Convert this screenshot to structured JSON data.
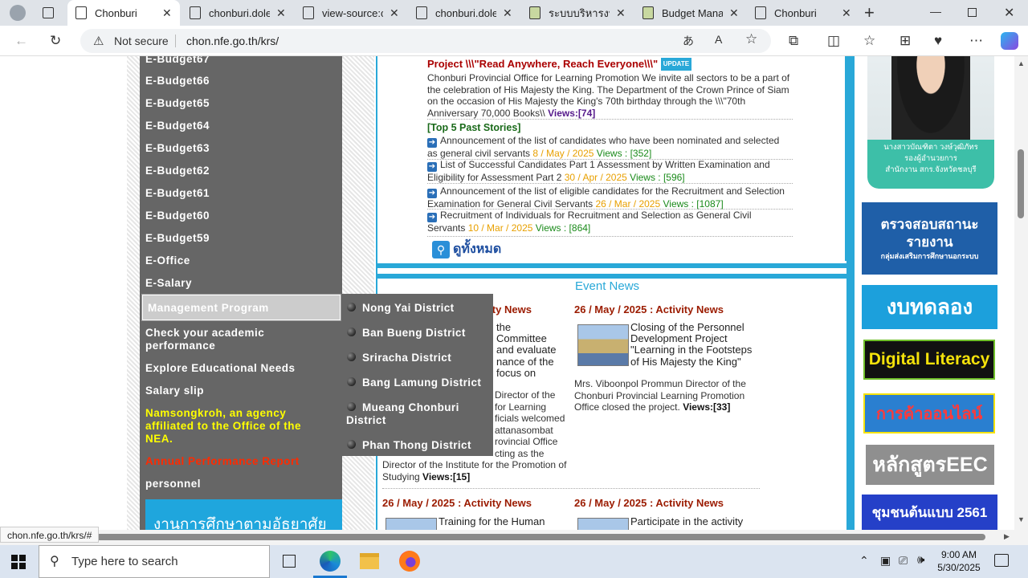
{
  "browser": {
    "tabs": [
      {
        "title": "Chonburi",
        "active": true
      },
      {
        "title": "chonburi.dole",
        "active": false
      },
      {
        "title": "view-source:c",
        "active": false
      },
      {
        "title": "chonburi.dole",
        "active": false
      },
      {
        "title": "ระบบบริหารงบป",
        "active": false
      },
      {
        "title": "Budget Manag",
        "active": false
      },
      {
        "title": "Chonburi",
        "active": false
      }
    ],
    "security_label": "Not secure",
    "url": "chon.nfe.go.th/krs/",
    "status_url": "chon.nfe.go.th/krs/#"
  },
  "sidebar": {
    "items": [
      {
        "label": "E-Budget67"
      },
      {
        "label": "E-Budget66"
      },
      {
        "label": "E-Budget65"
      },
      {
        "label": "E-Budget64"
      },
      {
        "label": "E-Budget63"
      },
      {
        "label": "E-Budget62"
      },
      {
        "label": "E-Budget61"
      },
      {
        "label": "E-Budget60"
      },
      {
        "label": "E-Budget59"
      },
      {
        "label": "E-Office"
      },
      {
        "label": "E-Salary"
      }
    ],
    "highlighted": "Management Program",
    "items_after": [
      {
        "label": "Check your academic performance"
      },
      {
        "label": "Explore Educational Needs"
      },
      {
        "label": "Salary slip"
      },
      {
        "label": "Namsongkroh, an agency affiliated to the Office of the NEA."
      },
      {
        "label": "Annual Performance Report"
      },
      {
        "label": "personnel"
      }
    ],
    "banner": "งานการศึกษาตามอัธยาศัย",
    "colors": {
      "background": "#666666",
      "yellow": "#ffff00",
      "red": "#ff2a00"
    }
  },
  "submenu": {
    "items": [
      {
        "label": "Nong Yai District"
      },
      {
        "label": "Ban Bueng District"
      },
      {
        "label": "Sriracha District"
      },
      {
        "label": "Bang Lamung District"
      },
      {
        "label": "Mueang Chonburi District"
      },
      {
        "label": "Phan Thong District"
      }
    ]
  },
  "content": {
    "top_story": {
      "title": "Project \\\\\\\"Read Anywhere, Reach Everyone\\\\\\\"",
      "badge": "UPDATE",
      "body": "Chonburi Provincial Office for Learning Promotion We invite all sectors to be a part of the celebration of His Majesty the King. The Department of the Crown Prince of Siam on the occasion of His Majesty the King's 70th birthday through the \\\\\\\"70th Anniversary 70,000 Books\\\\",
      "views_label": "Views:",
      "views": "[74]"
    },
    "past_title": "[Top 5 Past Stories]",
    "past_stories": [
      {
        "text": "Announcement of the list of candidates who have been nominated and selected as general civil servants",
        "date": "8 / May / 2025",
        "views": "Views : [352]"
      },
      {
        "text": "List of Successful Candidates Part 1 Assessment by Written Examination and Eligibility for Assessment Part 2",
        "date": "30 / Apr / 2025",
        "views": "Views : [596]"
      },
      {
        "text": "Announcement of the list of eligible candidates for the Recruitment and Selection Examination for General Civil Servants",
        "date": "26 / Mar / 2025",
        "views": "Views : [1087]"
      },
      {
        "text": "Recruitment of Individuals for Recruitment and Selection as General Civil Servants",
        "date": "10 / Mar / 2025",
        "views": "Views : [864]"
      }
    ],
    "view_all": "ดูทั้งหมด",
    "event_title": "Event News",
    "events": [
      {
        "heading": "26 / May / 2025 : Activity News",
        "title": "the ... Committee ... and evaluate ... nance of the ... focus on",
        "desc": "... Director of the ... for Learning ... ficials welcomed ... attanasombat ... rovincial Office ... cting as the Director of the Institute for the Promotion of Studying",
        "views": "Views:[15]"
      },
      {
        "heading": "26 / May / 2025 : Activity News",
        "title": "Closing of the Personnel Development Project \"Learning in the Footsteps of His Majesty the King\"",
        "desc": "Mrs. Viboonpol Prommun Director of the Chonburi Provincial Learning Promotion Office closed the project",
        "views": "Views:[33]"
      },
      {
        "heading": "26 / May / 2025 : Activity News",
        "title": "Training for the Human",
        "desc": "",
        "views": ""
      },
      {
        "heading": "26 / May / 2025 : Activity News",
        "title": "Participate in the activity",
        "desc": "",
        "views": ""
      }
    ]
  },
  "right": {
    "person_name": "นางสาวบัณฑิตา วงษ์วุฒิภัทร",
    "person_title": "รองผู้อำนวยการ",
    "person_org": "สำนักงาน สกร.จังหวัดชลบุรี",
    "banners": [
      {
        "line1": "ตรวจสอบสถานะ",
        "line2": "รายงาน",
        "line3": "กลุ่มส่งเสริมการศึกษานอกระบบ",
        "bg": "#1f5fa8"
      },
      {
        "line1": "งบทดลอง",
        "bg": "#1ca0dc"
      },
      {
        "line1": "Digital Literacy",
        "bg": "#111111"
      },
      {
        "line1": "การค้าออนไลน์",
        "bg": "#2a7fd0"
      },
      {
        "line1": "หลักสูตรEEC",
        "bg": "#8f8f8f"
      },
      {
        "line1": "ชุมชนต้นแบบ 2561",
        "bg": "#2540c8"
      }
    ]
  },
  "taskbar": {
    "search_placeholder": "Type here to search",
    "time": "9:00 AM",
    "date": "5/30/2025"
  }
}
